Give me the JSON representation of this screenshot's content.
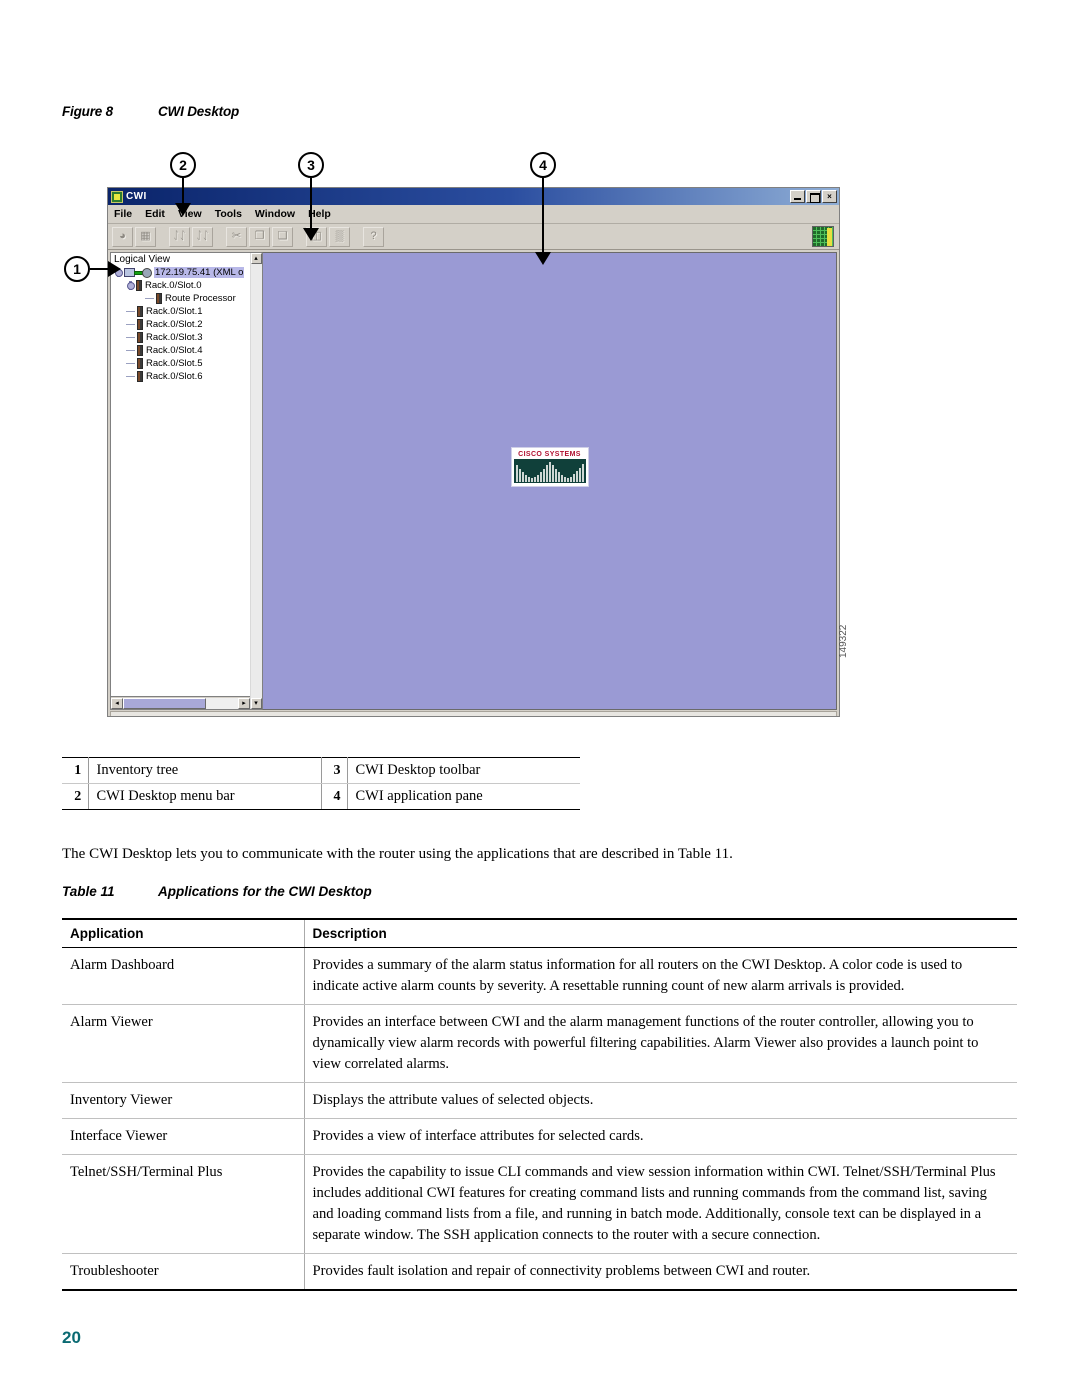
{
  "figure": {
    "label": "Figure 8",
    "title": "CWI Desktop",
    "image_id": "149322"
  },
  "callouts": [
    {
      "number": "1"
    },
    {
      "number": "2"
    },
    {
      "number": "3"
    },
    {
      "number": "4"
    }
  ],
  "screenshot": {
    "window_title": "CWI",
    "window_buttons": {
      "minimize": "minimize-icon",
      "maximize": "maximize-icon",
      "close": "×"
    },
    "menu": [
      {
        "label": "File",
        "mnemonic": "F"
      },
      {
        "label": "Edit",
        "mnemonic": "E"
      },
      {
        "label": "View",
        "mnemonic": "V"
      },
      {
        "label": "Tools",
        "mnemonic": "T"
      },
      {
        "label": "Window",
        "mnemonic": "W"
      },
      {
        "label": "Help",
        "mnemonic": "H"
      }
    ],
    "toolbar": {
      "buttons": [
        {
          "name": "open-icon",
          "glyph": "◕"
        },
        {
          "name": "chart-icon",
          "glyph": "▦"
        },
        {
          "name": "find-icon",
          "glyph": "ᛇᛇ"
        },
        {
          "name": "find-next-icon",
          "glyph": "ᛇᛇ"
        },
        {
          "name": "cut-icon",
          "glyph": "✂"
        },
        {
          "name": "copy-icon",
          "glyph": "❐"
        },
        {
          "name": "paste-icon",
          "glyph": "❑"
        },
        {
          "name": "book-icon",
          "glyph": "◫"
        },
        {
          "name": "grid-icon",
          "glyph": "▒"
        },
        {
          "name": "help-icon",
          "glyph": "?"
        }
      ],
      "right_icon": "network-grid-icon"
    },
    "tree": {
      "title": "Logical View",
      "nodes": [
        {
          "label": "172.19.75.41 (XML o",
          "selected": true,
          "level": 0,
          "icon": "host-icon"
        },
        {
          "label": "Rack.0/Slot.0",
          "selected": false,
          "level": 1,
          "icon": "card-icon"
        },
        {
          "label": "Route Processor",
          "selected": false,
          "level": 2,
          "icon": "card-icon"
        },
        {
          "label": "Rack.0/Slot.1",
          "selected": false,
          "level": 1,
          "icon": "card-icon"
        },
        {
          "label": "Rack.0/Slot.2",
          "selected": false,
          "level": 1,
          "icon": "card-icon"
        },
        {
          "label": "Rack.0/Slot.3",
          "selected": false,
          "level": 1,
          "icon": "card-icon"
        },
        {
          "label": "Rack.0/Slot.4",
          "selected": false,
          "level": 1,
          "icon": "card-icon"
        },
        {
          "label": "Rack.0/Slot.5",
          "selected": false,
          "level": 1,
          "icon": "card-icon"
        },
        {
          "label": "Rack.0/Slot.6",
          "selected": false,
          "level": 1,
          "icon": "card-icon"
        }
      ]
    },
    "app_pane": {
      "logo_text": "CISCO SYSTEMS",
      "background_color": "#9a9ad4"
    }
  },
  "legend": {
    "rows": [
      {
        "n1": "1",
        "l1": "Inventory tree",
        "n2": "3",
        "l2": "CWI Desktop toolbar"
      },
      {
        "n1": "2",
        "l1": "CWI Desktop menu bar",
        "n2": "4",
        "l2": "CWI application pane"
      }
    ]
  },
  "body": {
    "paragraph": "The CWI Desktop lets you to communicate with the router using the applications that are described in Table 11."
  },
  "table": {
    "label": "Table 11",
    "title": "Applications for the CWI Desktop",
    "headers": {
      "col1": "Application",
      "col2": "Description"
    },
    "rows": [
      {
        "application": "Alarm Dashboard",
        "description": "Provides a summary of the alarm status information for all routers on the CWI Desktop. A color code is used to indicate active alarm counts by severity. A resettable running count of new alarm arrivals is provided."
      },
      {
        "application": "Alarm Viewer",
        "description": "Provides an interface between CWI and the alarm management functions of the router controller, allowing you to dynamically view alarm records with powerful filtering capabilities. Alarm Viewer also provides a launch point to view correlated alarms."
      },
      {
        "application": "Inventory Viewer",
        "description": "Displays the attribute values of selected objects."
      },
      {
        "application": "Interface Viewer",
        "description": "Provides a view of interface attributes for selected cards."
      },
      {
        "application": "Telnet/SSH/Terminal Plus",
        "description": "Provides the capability to issue CLI commands and view session information within CWI. Telnet/SSH/Terminal Plus includes additional CWI features for creating command lists and running commands from the command list, saving and loading command lists from a file, and running in batch mode. Additionally, console text can be displayed in a separate window. The SSH application connects to the router with a secure connection."
      },
      {
        "application": "Troubleshooter",
        "description": "Provides fault isolation and repair of connectivity problems between CWI and router."
      }
    ]
  },
  "footer": {
    "page_number": "20"
  }
}
